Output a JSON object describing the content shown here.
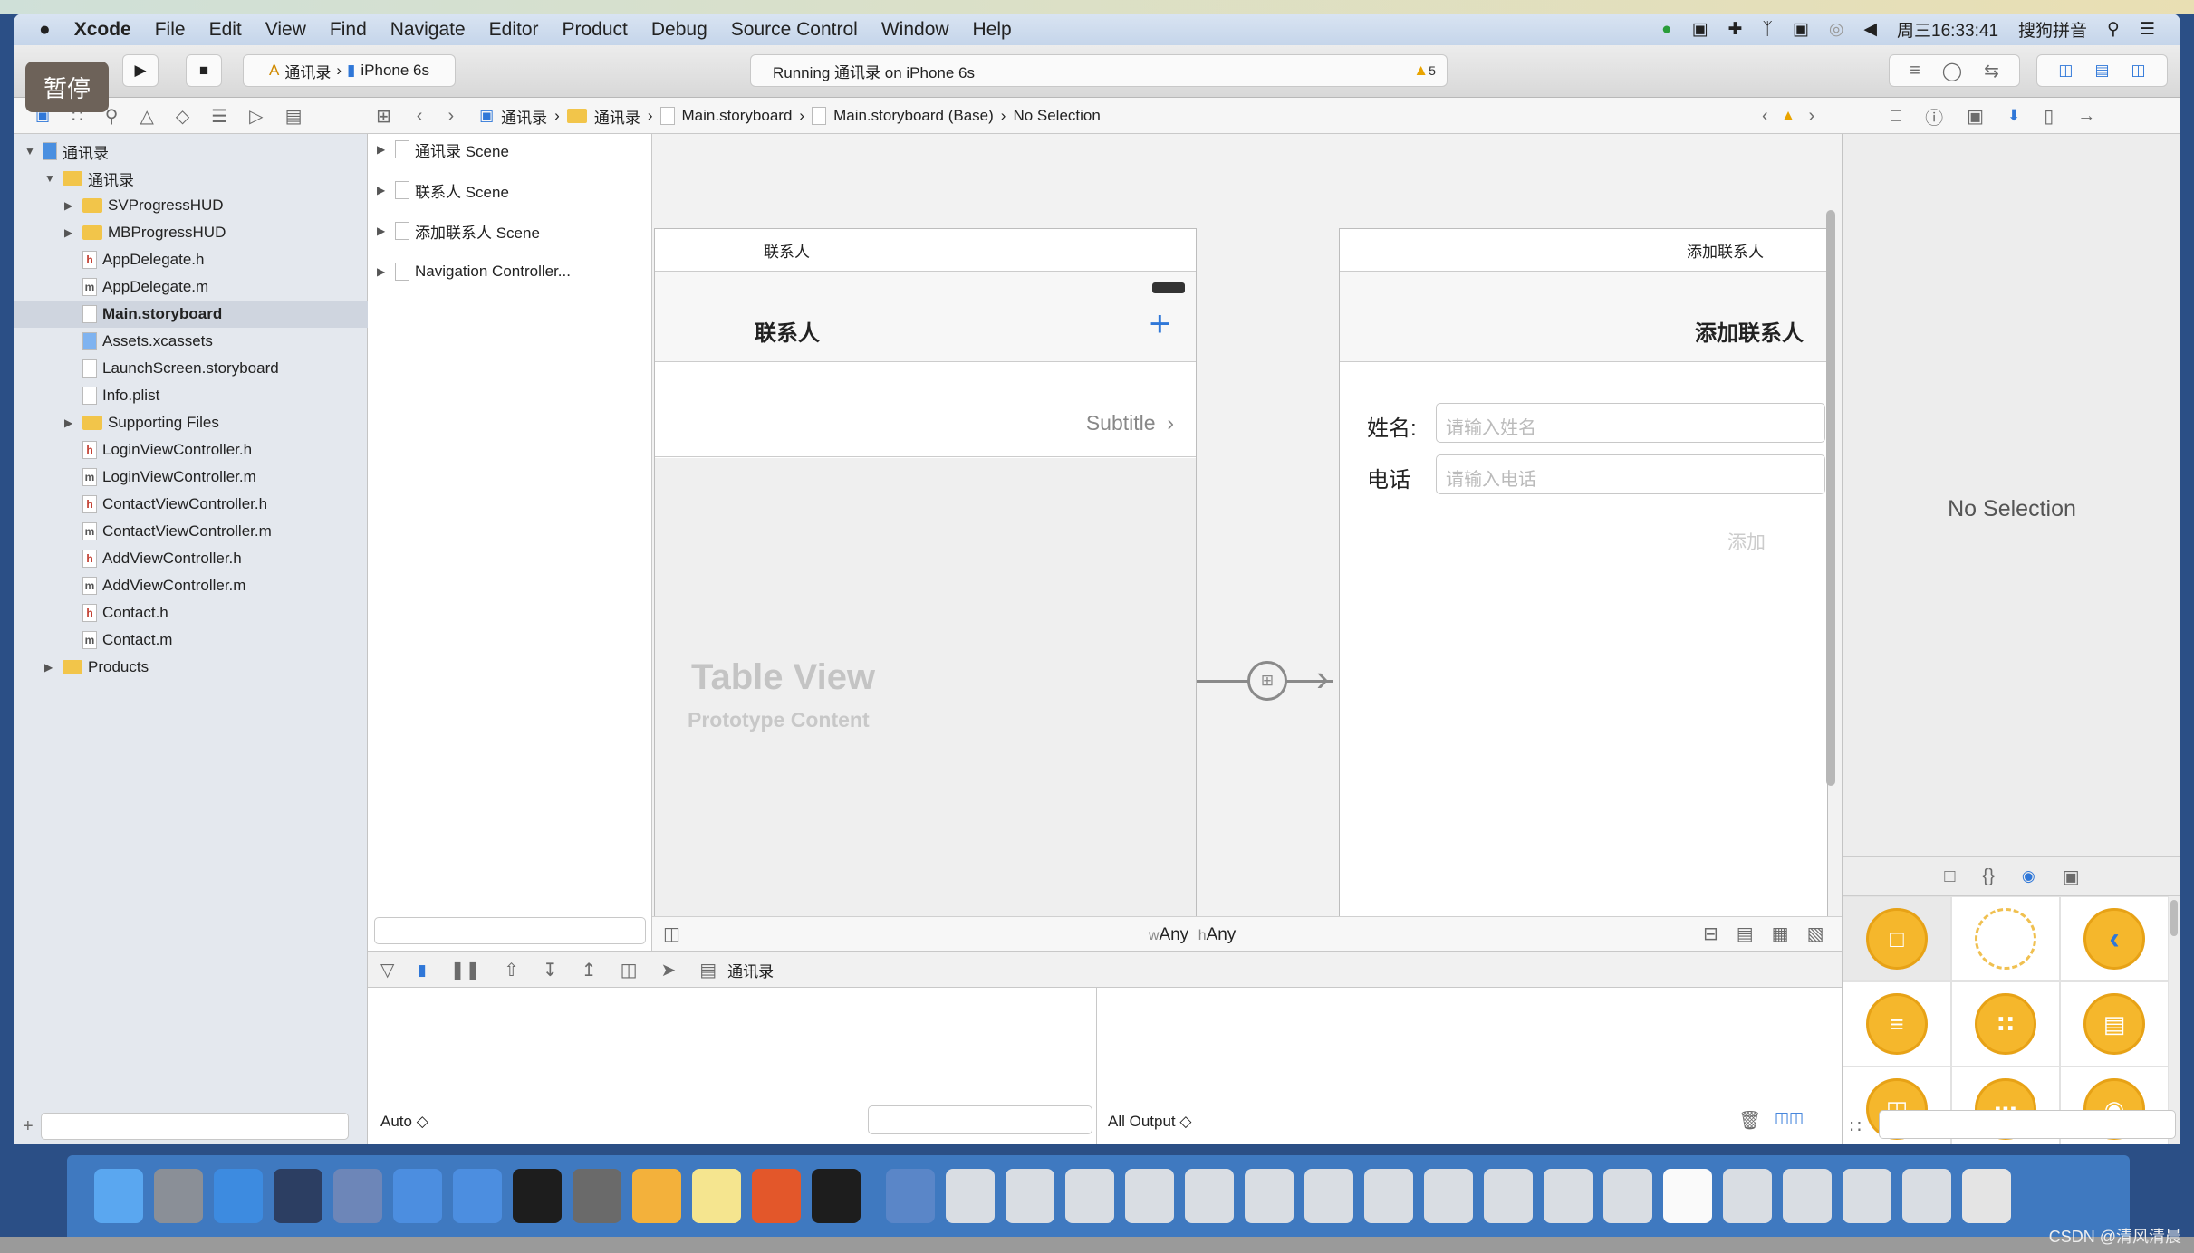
{
  "menubar": {
    "app": "Xcode",
    "items": [
      "File",
      "Edit",
      "View",
      "Find",
      "Navigate",
      "Editor",
      "Product",
      "Debug",
      "Source Control",
      "Window",
      "Help"
    ],
    "clock": "周三16:33:41",
    "input_method": "搜狗拼音"
  },
  "toolbar": {
    "pause_overlay": "暂停",
    "scheme": "通讯录",
    "device": "iPhone 6s",
    "activity": "Running 通讯录 on iPhone 6s",
    "warning_count": "5"
  },
  "pathbar": {
    "crumbs": [
      "通讯录",
      "通讯录",
      "Main.storyboard",
      "Main.storyboard (Base)",
      "No Selection"
    ]
  },
  "navigator": {
    "items": [
      {
        "label": "通讯录",
        "kind": "project",
        "depth": 0,
        "open": true
      },
      {
        "label": "通讯录",
        "kind": "folder",
        "depth": 1,
        "open": true
      },
      {
        "label": "SVProgressHUD",
        "kind": "folder",
        "depth": 2,
        "open": false
      },
      {
        "label": "MBProgressHUD",
        "kind": "folder",
        "depth": 2,
        "open": false
      },
      {
        "label": "AppDelegate.h",
        "kind": "h",
        "depth": 2
      },
      {
        "label": "AppDelegate.m",
        "kind": "m",
        "depth": 2
      },
      {
        "label": "Main.storyboard",
        "kind": "sb",
        "depth": 2,
        "selected": true
      },
      {
        "label": "Assets.xcassets",
        "kind": "assets",
        "depth": 2
      },
      {
        "label": "LaunchScreen.storyboard",
        "kind": "sb",
        "depth": 2
      },
      {
        "label": "Info.plist",
        "kind": "plist",
        "depth": 2
      },
      {
        "label": "Supporting Files",
        "kind": "folder",
        "depth": 2,
        "open": false
      },
      {
        "label": "LoginViewController.h",
        "kind": "h",
        "depth": 2
      },
      {
        "label": "LoginViewController.m",
        "kind": "m",
        "depth": 2
      },
      {
        "label": "ContactViewController.h",
        "kind": "h",
        "depth": 2
      },
      {
        "label": "ContactViewController.m",
        "kind": "m",
        "depth": 2
      },
      {
        "label": "AddViewController.h",
        "kind": "h",
        "depth": 2
      },
      {
        "label": "AddViewController.m",
        "kind": "m",
        "depth": 2
      },
      {
        "label": "Contact.h",
        "kind": "h",
        "depth": 2
      },
      {
        "label": "Contact.m",
        "kind": "m",
        "depth": 2
      },
      {
        "label": "Products",
        "kind": "folder",
        "depth": 1,
        "open": false
      }
    ]
  },
  "outline": {
    "scenes": [
      "通讯录 Scene",
      "联系人 Scene",
      "添加联系人 Scene",
      "Navigation Controller..."
    ]
  },
  "scene_contacts": {
    "header": "联系人",
    "nav_title": "联系人",
    "add_icon": "+",
    "cell_subtitle": "Subtitle",
    "table_title": "Table View",
    "table_subtitle": "Prototype Content"
  },
  "scene_add": {
    "header": "添加联系人",
    "nav_title": "添加联系人",
    "name_label": "姓名:",
    "name_placeholder": "请输入姓名",
    "phone_label": "电话",
    "phone_placeholder": "请输入电话",
    "add_button": "添加"
  },
  "canvasbar": {
    "w_label": "w",
    "w_value": "Any",
    "h_label": "h",
    "h_value": "Any"
  },
  "debug": {
    "target": "通讯录",
    "auto": "Auto ◇",
    "output": "All Output ◇"
  },
  "inspector": {
    "empty": "No Selection"
  },
  "watermark": "CSDN @清风清晨",
  "dock_colors": [
    "#5aa7f0",
    "#8a8f97",
    "#3d8be0",
    "#2c3e62",
    "#6d86b8",
    "#4c8ee0",
    "#4c8ee0",
    "#1d1d1d",
    "#6a6a6a",
    "#f3b13b",
    "#f5e58f",
    "#e3572a",
    "#1d1d1d",
    "#5a86c8",
    "#d9dde3",
    "#d9dde3",
    "#d9dde3",
    "#d9dde3",
    "#d9dde3",
    "#d9dde3",
    "#d9dde3",
    "#d9dde3",
    "#d9dde3",
    "#d9dde3",
    "#d9dde3",
    "#d9dde3",
    "#fafafa",
    "#d9dde3",
    "#d9dde3",
    "#d9dde3",
    "#d9dde3",
    "#e4e4e4"
  ]
}
